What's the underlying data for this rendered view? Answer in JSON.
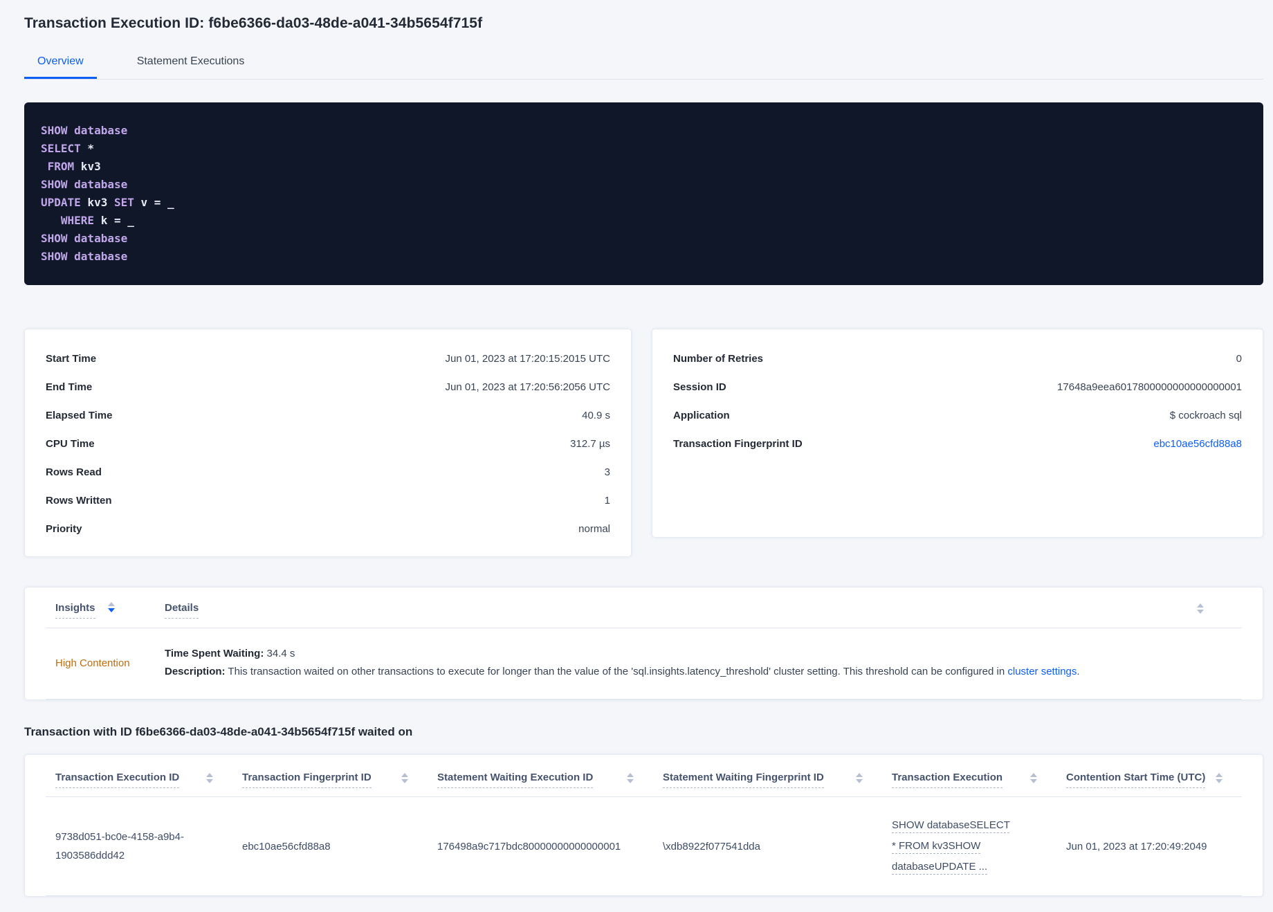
{
  "page": {
    "title": "Transaction Execution ID: f6be6366-da03-48de-a041-34b5654f715f"
  },
  "colors": {
    "accent_blue": "#0d5ef5",
    "insight_warning_orange": "#bf6c0e",
    "code_background": "#0f1729",
    "code_keyword_lavender": "#c1a7ea",
    "code_plain": "#e8eaf4"
  },
  "tabs": [
    {
      "label": "Overview",
      "active": true
    },
    {
      "label": "Statement Executions",
      "active": false
    }
  ],
  "sql_box": {
    "lines": [
      [
        [
          "SHOW database",
          "kw"
        ]
      ],
      [
        [
          "SELECT",
          "kw"
        ],
        [
          " *",
          "plain"
        ]
      ],
      [
        [
          " FROM",
          "kw"
        ],
        [
          " kv3",
          "plain"
        ]
      ],
      [
        [
          "SHOW database",
          "kw"
        ]
      ],
      [
        [
          "UPDATE",
          "kw"
        ],
        [
          " kv3 ",
          "plain"
        ],
        [
          "SET",
          "kw"
        ],
        [
          " v = _",
          "plain"
        ]
      ],
      [
        [
          "   WHERE",
          "kw"
        ],
        [
          " k = _",
          "plain"
        ]
      ],
      [
        [
          "SHOW database",
          "kw"
        ]
      ],
      [
        [
          "SHOW database",
          "kw"
        ]
      ]
    ]
  },
  "stats_left": {
    "rows": [
      {
        "label": "Start Time",
        "value": "Jun 01, 2023 at 17:20:15:2015 UTC"
      },
      {
        "label": "End Time",
        "value": "Jun 01, 2023 at 17:20:56:2056 UTC"
      },
      {
        "label": "Elapsed Time",
        "value": "40.9 s"
      },
      {
        "label": "CPU Time",
        "value": "312.7 µs"
      },
      {
        "label": "Rows Read",
        "value": "3"
      },
      {
        "label": "Rows Written",
        "value": "1"
      },
      {
        "label": "Priority",
        "value": "normal"
      }
    ]
  },
  "stats_right": {
    "rows": [
      {
        "label": "Number of Retries",
        "value": "0"
      },
      {
        "label": "Session ID",
        "value": "17648a9eea6017800000000000000001"
      },
      {
        "label": "Application",
        "value": "$ cockroach sql"
      },
      {
        "label": "Transaction Fingerprint ID",
        "value": "ebc10ae56cfd88a8",
        "link": true
      }
    ]
  },
  "insights": {
    "columns": [
      "Insights",
      "Details"
    ],
    "rows": [
      {
        "insight": "High Contention",
        "waiting_label": "Time Spent Waiting:",
        "waiting_value": "34.4 s",
        "description_label": "Description:",
        "description_text": "This transaction waited on other transactions to execute for longer than the value of the 'sql.insights.latency_threshold' cluster setting. This threshold can be configured in ",
        "description_link": "cluster settings",
        "description_suffix": "."
      }
    ]
  },
  "waited_on": {
    "heading": "Transaction with ID f6be6366-da03-48de-a041-34b5654f715f waited on",
    "columns": [
      {
        "label": "Transaction Execution ID",
        "key": "txn_execution_id",
        "name": "transaction-execution-id"
      },
      {
        "label": "Transaction Fingerprint ID",
        "key": "txn_fingerprint_id",
        "name": "transaction-fingerprint-id"
      },
      {
        "label": "Statement Waiting Execution ID",
        "key": "stmt_waiting_execution_id",
        "name": "statement-waiting-execution-id"
      },
      {
        "label": "Statement Waiting Fingerprint ID",
        "key": "stmt_waiting_fingerprint_id",
        "name": "statement-waiting-fingerprint-id"
      },
      {
        "label": "Transaction Execution",
        "key": "txn_execution",
        "name": "transaction-execution"
      },
      {
        "label": "Contention Start Time (UTC)",
        "key": "contention_start",
        "name": "contention-start-time"
      }
    ],
    "rows": [
      {
        "txn_execution_id": "9738d051-bc0e-4158-a9b4-1903586ddd42",
        "txn_fingerprint_id": "ebc10ae56cfd88a8",
        "stmt_waiting_execution_id": "176498a9c717bdc80000000000000001",
        "stmt_waiting_fingerprint_id": "\\xdb8922f077541dda",
        "txn_execution": "SHOW databaseSELECT * FROM kv3SHOW databaseUPDATE ...",
        "contention_start": "Jun 01, 2023 at 17:20:49:2049"
      }
    ]
  }
}
